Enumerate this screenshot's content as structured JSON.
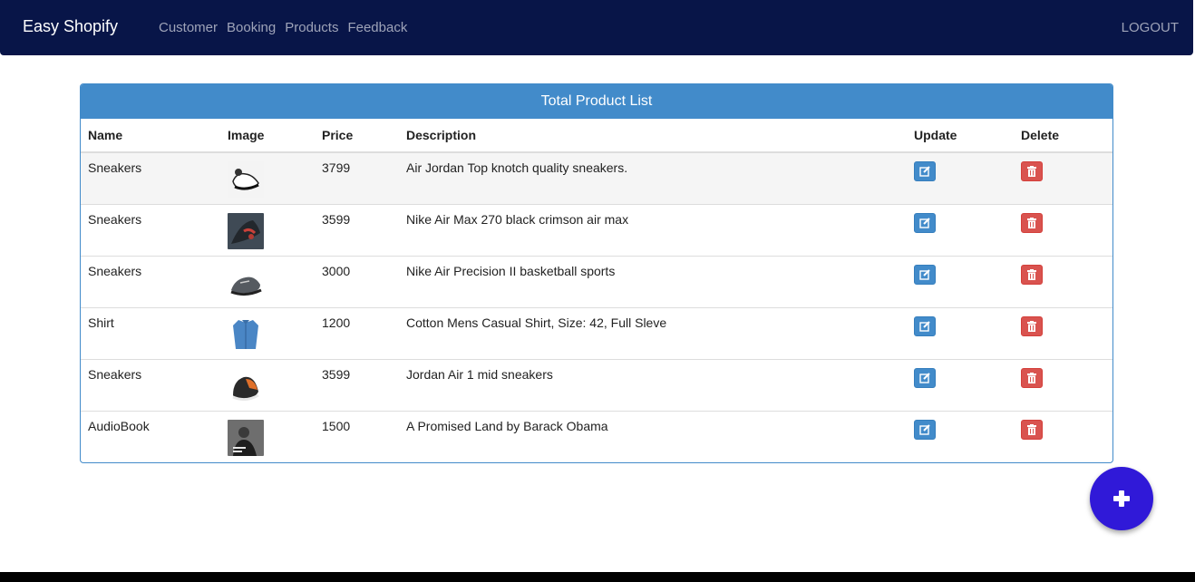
{
  "navbar": {
    "brand": "Easy Shopify",
    "links": [
      "Customer",
      "Booking",
      "Products",
      "Feedback"
    ],
    "logout": "LOGOUT"
  },
  "panel": {
    "title": "Total Product List"
  },
  "table": {
    "columns": [
      "Name",
      "Image",
      "Price",
      "Description",
      "Update",
      "Delete"
    ],
    "rows": [
      {
        "name": "Sneakers",
        "image_icon": "white-sneaker-photo",
        "price": "3799",
        "description": "Air Jordan Top knotch quality sneakers."
      },
      {
        "name": "Sneakers",
        "image_icon": "dark-sneaker-photo",
        "price": "3599",
        "description": "Nike Air Max 270 black crimson air max"
      },
      {
        "name": "Sneakers",
        "image_icon": "grey-sneaker-photo",
        "price": "3000",
        "description": "Nike Air Precision II basketball sports"
      },
      {
        "name": "Shirt",
        "image_icon": "blue-shirt-photo",
        "price": "1200",
        "description": "Cotton Mens Casual Shirt, Size: 42, Full Sleve"
      },
      {
        "name": "Sneakers",
        "image_icon": "orange-sneaker-photo",
        "price": "3599",
        "description": "Jordan Air 1 mid sneakers"
      },
      {
        "name": "AudioBook",
        "image_icon": "book-cover-photo",
        "price": "1500",
        "description": "A Promised Land by Barack Obama"
      }
    ]
  },
  "colors": {
    "navbar": "#081548",
    "panel": "#428bca",
    "edit": "#428bca",
    "delete": "#d9534f",
    "fab": "#3019d8"
  }
}
